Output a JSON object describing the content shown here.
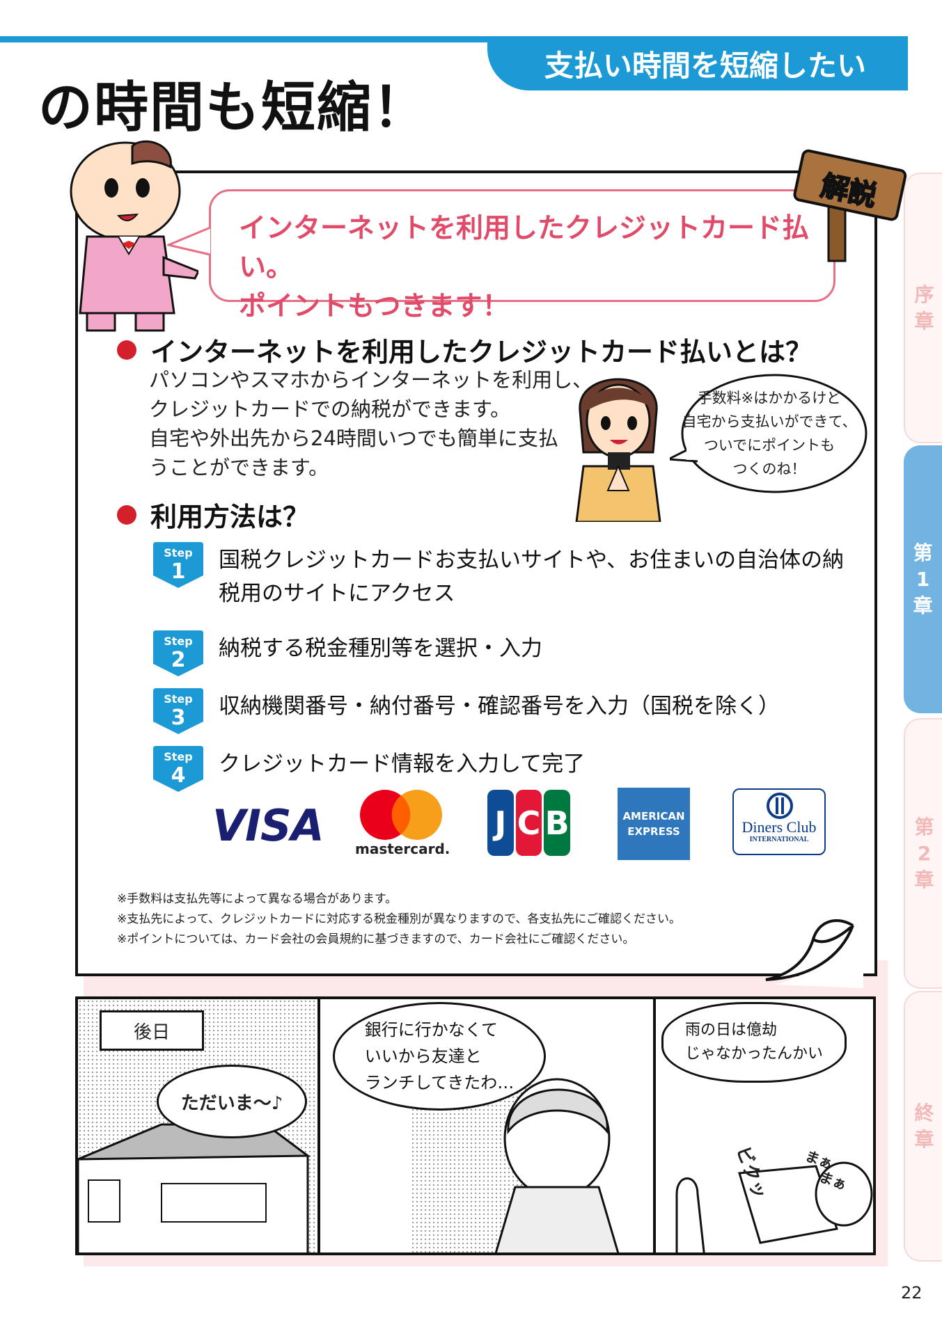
{
  "header": {
    "headline": "の時間も短縮！",
    "section_tag": "支払い時間を短縮したい"
  },
  "sign_label": "解説",
  "speech": {
    "line1": "インターネットを利用したクレジットカード払い。",
    "line2": "ポイントもつきます！"
  },
  "section1": {
    "heading": "インターネットを利用したクレジットカード払いとは？",
    "body": [
      "パソコンやスマホからインターネットを利用し、",
      "クレジットカードでの納税ができます。",
      "自宅や外出先から24時間いつでも簡単に支払",
      "うことができます。"
    ]
  },
  "woman_bubble": [
    "手数料※はかかるけど",
    "自宅から支払いができて、",
    "ついでにポイントも",
    "つくのね！"
  ],
  "section2": {
    "heading": "利用方法は？",
    "step_word": "Step",
    "steps": [
      {
        "num": "1",
        "line1": "国税クレジットカードお支払いサイトや、お住まいの自治体の納",
        "line2": "税用のサイトにアクセス"
      },
      {
        "num": "2",
        "line1": "納税する税金種別等を選択・入力",
        "line2": ""
      },
      {
        "num": "3",
        "line1": "収納機関番号・納付番号・確認番号を入力（国税を除く）",
        "line2": ""
      },
      {
        "num": "4",
        "line1": "クレジットカード情報を入力して完了",
        "line2": ""
      }
    ]
  },
  "logos": {
    "visa": "VISA",
    "mastercard": "mastercard.",
    "jcb": [
      "J",
      "C",
      "B"
    ],
    "amex": [
      "AMERICAN",
      "EXPRESS"
    ],
    "diners": [
      "Diners Club",
      "INTERNATIONAL"
    ]
  },
  "notes": [
    "※手数料は支払先等によって異なる場合があります。",
    "※支払先によって、クレジットカードに対応する税金種別が異なりますので、各支払先にご確認ください。",
    "※ポイントについては、カード会社の会員規約に基づきますので、カード会社にご確認ください。"
  ],
  "comic": {
    "caption": "後日",
    "panel1_speech": "ただいま〜♪",
    "panel2_speech": [
      "銀行に行かなくて",
      "いいから友達と",
      "ランチしてきたわ…"
    ],
    "panel3_speech": [
      "雨の日は億劫",
      "じゃなかったんかい"
    ],
    "sfx_bikun": "ビクッ",
    "sfx_mama": [
      "まぁ",
      "まぁ"
    ]
  },
  "chapter_tabs": [
    {
      "label": [
        "序",
        "章"
      ],
      "active": false
    },
    {
      "label": [
        "第",
        "1",
        "章"
      ],
      "active": true
    },
    {
      "label": [
        "第",
        "2",
        "章"
      ],
      "active": false
    },
    {
      "label": [
        "終",
        "章"
      ],
      "active": false
    }
  ],
  "page_number": "22",
  "colors": {
    "accent_blue": "#1c9ad6",
    "speech_pink": "#e14b6a",
    "bullet_red": "#d4202d",
    "tab_active": "#73b3e2"
  }
}
